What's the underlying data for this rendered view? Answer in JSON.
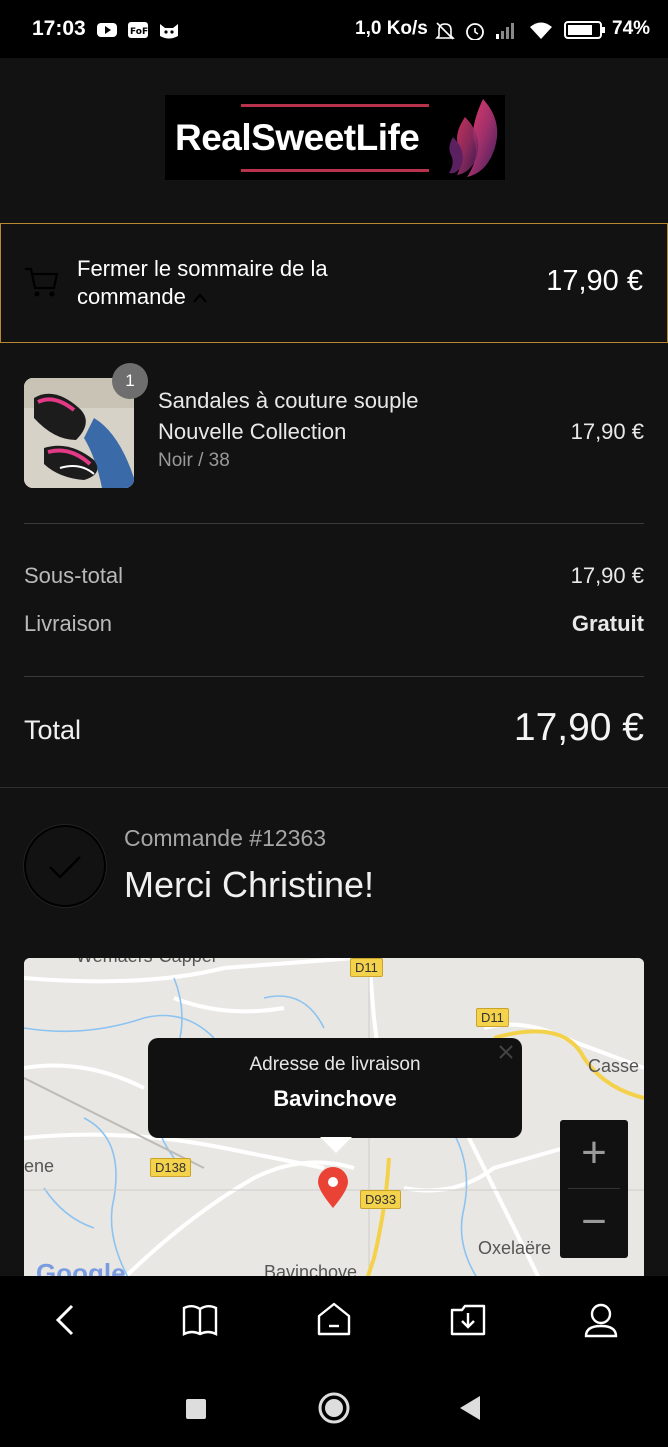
{
  "status_bar": {
    "time": "17:03",
    "network_speed": "1,0 Ko/s",
    "battery_percent": "74%",
    "icons": [
      "youtube-icon",
      "fof-icon",
      "cat-app-icon",
      "mute-icon",
      "alarm-icon",
      "signal-icon",
      "wifi-icon",
      "battery-icon"
    ]
  },
  "brand": {
    "logo_text": "RealSweetLife",
    "colors": {
      "logo_line": "#b8324b",
      "toggle_border": "#b8872f"
    }
  },
  "summary_toggle": {
    "label": "Fermer le sommaire de la commande",
    "total": "17,90 €"
  },
  "line_items": [
    {
      "quantity": "1",
      "name": "Sandales à couture souple Nouvelle Collection",
      "variant": "Noir / 38",
      "price": "17,90 €"
    }
  ],
  "totals": {
    "subtotal_label": "Sous-total",
    "subtotal_value": "17,90 €",
    "shipping_label": "Livraison",
    "shipping_value": "Gratuit",
    "total_label": "Total",
    "total_value": "17,90 €"
  },
  "confirmation": {
    "order_number": "Commande #12363",
    "thank_you": "Merci Christine!"
  },
  "map": {
    "popup_title": "Adresse de livraison",
    "popup_place": "Bavinchove",
    "labels": {
      "top_left_town": "Wemaers-Cappel",
      "left_edge": "ene",
      "cassel": "Casse",
      "oxelaere": "Oxelaëre",
      "bottom_town": "Bavinchove",
      "google": "Google"
    },
    "roads": [
      "D11",
      "D11",
      "D138",
      "D933"
    ],
    "zoom_in": "+",
    "zoom_out": "−"
  },
  "bottom_nav": [
    "back-icon",
    "book-icon",
    "home-icon",
    "download-icon",
    "account-icon"
  ],
  "system_nav": [
    "recents-button",
    "home-button",
    "back-button"
  ]
}
